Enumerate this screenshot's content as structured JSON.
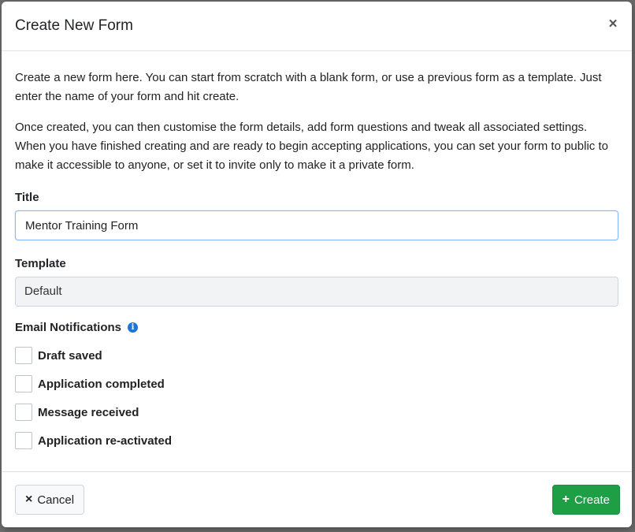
{
  "modal": {
    "title": "Create New Form",
    "close_glyph": "×",
    "intro_paragraphs": [
      "Create a new form here. You can start from scratch with a blank form, or use a previous form as a template. Just enter the name of your form and hit create.",
      "Once created, you can then customise the form details, add form questions and tweak all associated settings. When you have finished creating and are ready to begin accepting applications, you can set your form to public to make it accessible to anyone, or set it to invite only to make it a private form."
    ],
    "title_field": {
      "label": "Title",
      "value": "Mentor Training Form"
    },
    "template_field": {
      "label": "Template",
      "value": "Default"
    },
    "email_notifications": {
      "label": "Email Notifications",
      "info_icon": "info-circle-icon",
      "options": [
        {
          "label": "Draft saved",
          "checked": false
        },
        {
          "label": "Application completed",
          "checked": false
        },
        {
          "label": "Message received",
          "checked": false
        },
        {
          "label": "Application re-activated",
          "checked": false
        }
      ]
    },
    "footer": {
      "cancel_icon": "×",
      "cancel_label": "Cancel",
      "create_icon": "+",
      "create_label": "Create"
    }
  },
  "colors": {
    "accent_blue": "#1d75d8",
    "create_green": "#1e9e45",
    "focus_border": "#86b7fe"
  }
}
